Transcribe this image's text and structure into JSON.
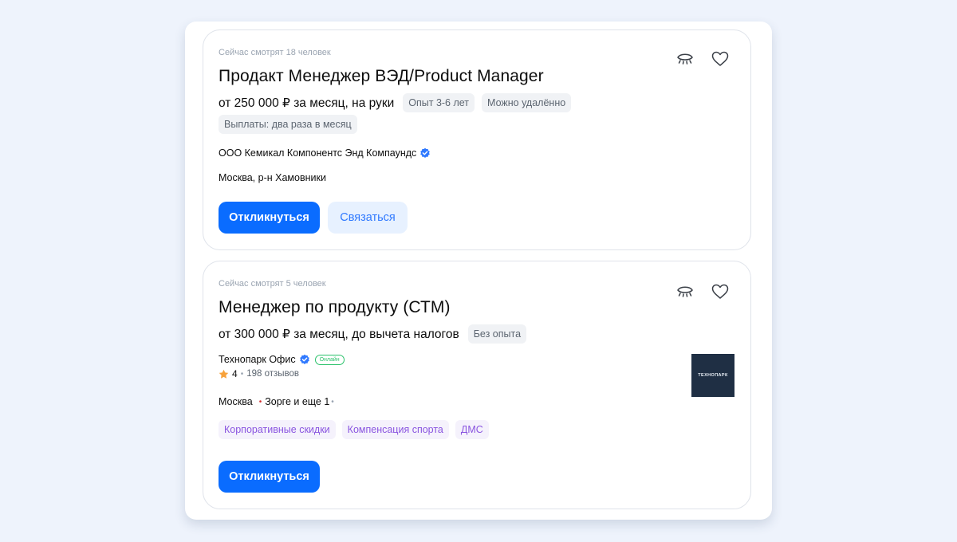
{
  "vacancies": [
    {
      "viewers": "Сейчас смотрят 18 человек",
      "title": "Продакт Менеджер ВЭД/Product Manager",
      "salary": "от 250 000 ₽ за месяц, на руки",
      "tags": [
        "Опыт 3-6 лет",
        "Можно удалённо"
      ],
      "extra_tag": "Выплаты: два раза в месяц",
      "company": "ООО Кемикал Компонентс Энд Компаундс",
      "location": "Москва, р-н Хамовники",
      "apply_label": "Откликнуться",
      "contact_label": "Связаться"
    },
    {
      "viewers": "Сейчас смотрят 5 человек",
      "title": "Менеджер по продукту (СТМ)",
      "salary": "от 300 000 ₽ за месяц, до вычета налогов",
      "tags": [
        "Без опыта"
      ],
      "company": "Технопарк Офис",
      "online_badge": "Онлайн",
      "rating": "4",
      "reviews": "198 отзывов",
      "location_city": "Москва",
      "location_metro": "Зорге и еще 1",
      "perks": [
        "Корпоративные скидки",
        "Компенсация спорта",
        "ДМС"
      ],
      "logo_text": "ТЕХНОПАРК",
      "apply_label": "Откликнуться"
    }
  ],
  "colors": {
    "primary": "#0a6cff",
    "secondary_bg": "#e7f1ff",
    "verified": "#2f79ff",
    "perk_text": "#8a55e0",
    "online": "#2bc26b",
    "star": "#f7a23b",
    "metro_dot": "#d3302f"
  },
  "icons": {
    "hide": "eye-closed-icon",
    "favorite": "heart-icon",
    "verified": "verified-check-icon",
    "star": "star-icon"
  }
}
